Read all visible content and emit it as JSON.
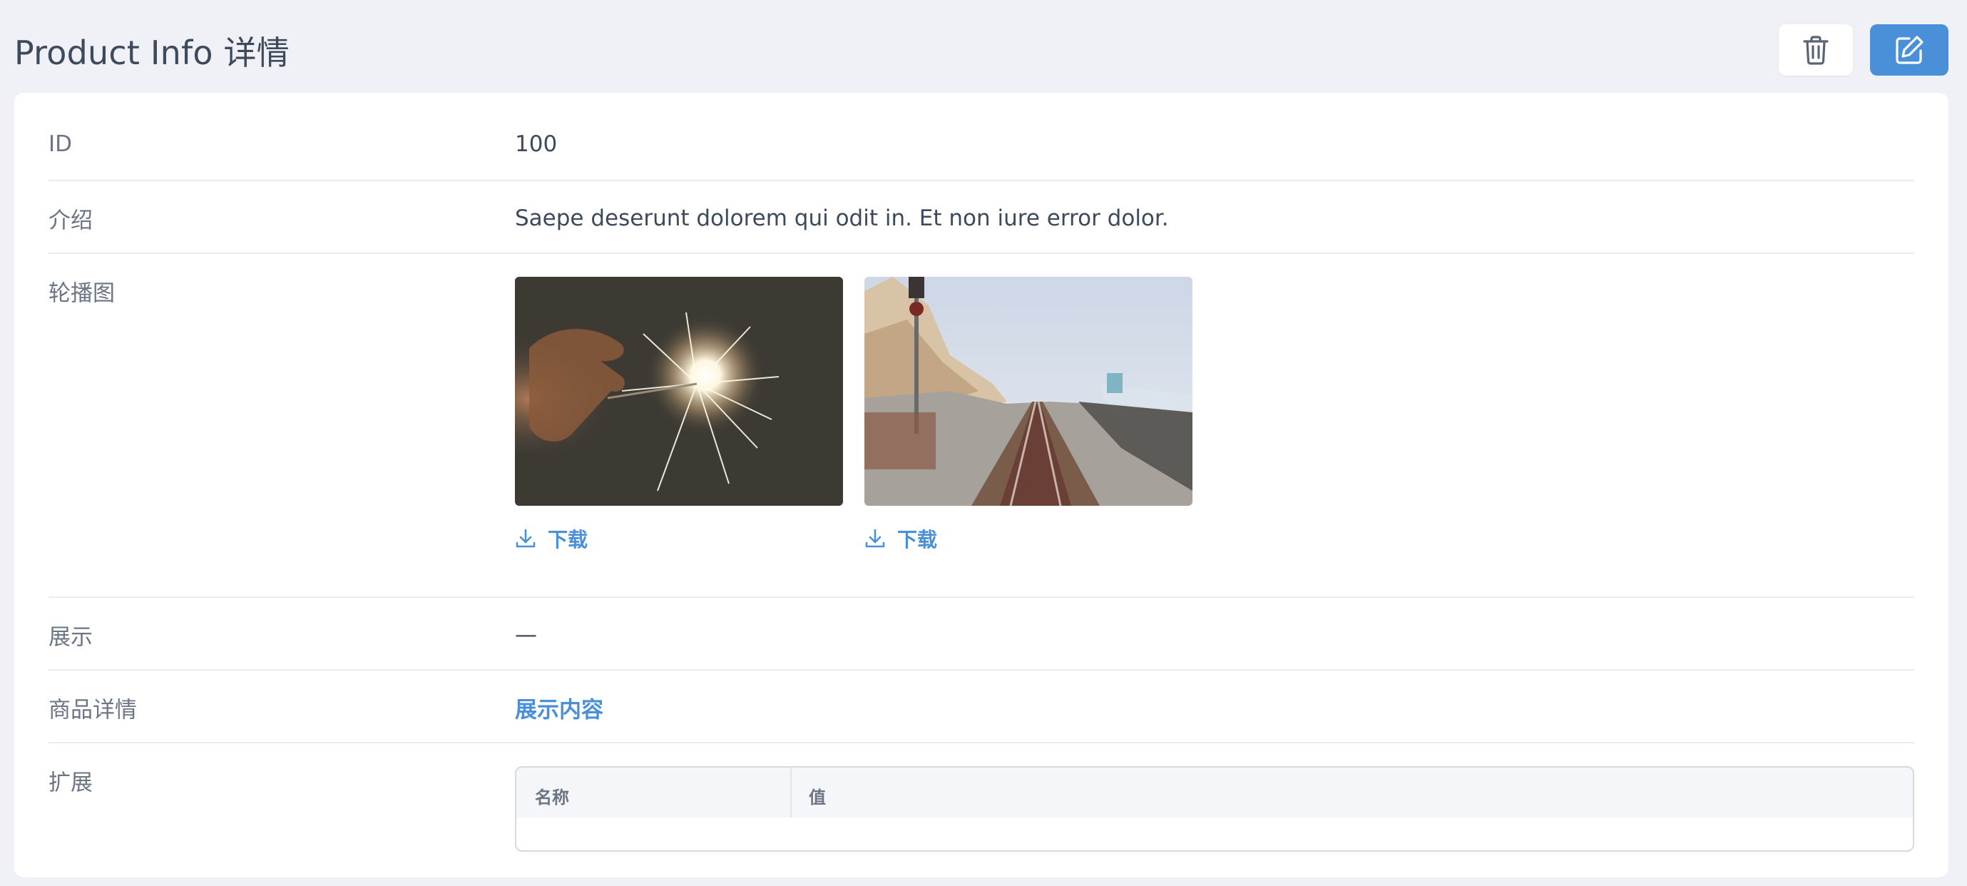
{
  "header": {
    "title": "Product Info 详情",
    "delete_icon": "trash-icon",
    "edit_icon": "edit-icon",
    "edit_color": "#4a90d9"
  },
  "fields": {
    "id": {
      "label": "ID",
      "value": "100"
    },
    "intro": {
      "label": "介绍",
      "value": "Saepe deserunt dolorem qui odit in. Et non iure error dolor."
    },
    "gallery": {
      "label": "轮播图",
      "items": [
        {
          "image": "sparkler-photo",
          "download_label": "下载"
        },
        {
          "image": "railway-coast-photo",
          "download_label": "下载"
        }
      ]
    },
    "show": {
      "label": "展示",
      "value": "—"
    },
    "detail": {
      "label": "商品详情",
      "value": "展示内容"
    },
    "extension": {
      "label": "扩展",
      "columns": [
        "名称",
        "值"
      ]
    }
  }
}
